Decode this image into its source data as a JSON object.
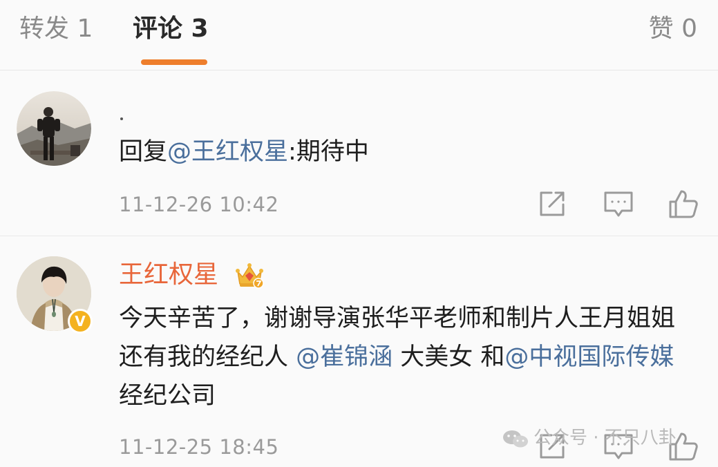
{
  "tabs": {
    "repost": "转发 1",
    "comments": "评论 3",
    "likes": "赞 0"
  },
  "colors": {
    "accent": "#ee7e2c",
    "username": "#e8663a",
    "mention": "#4a6f9c",
    "muted": "#9a9a9a",
    "verified": "#f4b220"
  },
  "comments": [
    {
      "reply_prefix": "回复",
      "mention": "@王红权星",
      "text": ":期待中",
      "timestamp": "11-12-26 10:42"
    },
    {
      "username": "王红权星",
      "badge_icon": "crown-icon",
      "verified_icon": "v-verified-icon",
      "text_part1": "今天辛苦了，谢谢导演张华平老师和制片人王月姐姐还有我的经纪人 ",
      "mention1": "@崔锦涵",
      "text_part2": " 大美女 和",
      "mention2": "@中视国际传媒",
      "text_part3": " 经纪公司",
      "timestamp": "11-12-25 18:45"
    }
  ],
  "actions": {
    "share_icon": "share-icon",
    "reply_icon": "comment-icon",
    "like_icon": "thumbs-up-icon"
  },
  "watermark": {
    "text": "公众号 · 不只八卦"
  }
}
